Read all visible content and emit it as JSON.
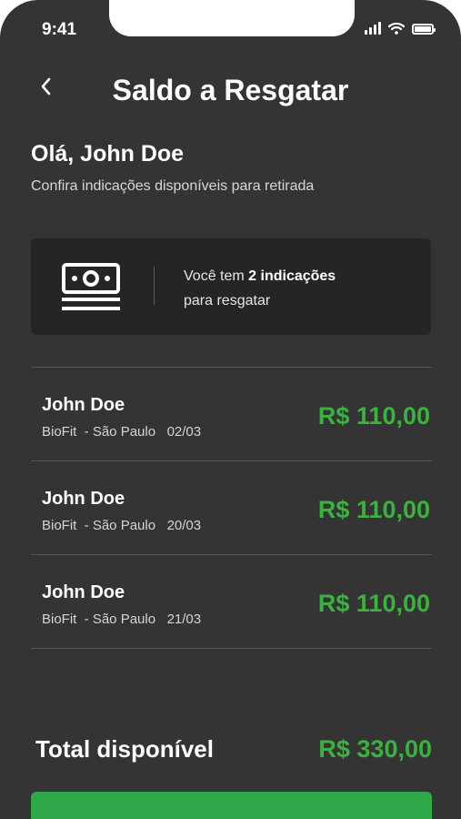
{
  "status_bar": {
    "time": "9:41"
  },
  "header": {
    "title": "Saldo a Resgatar"
  },
  "greeting": {
    "title": "Olá, John Doe",
    "subtitle": "Confira indicações disponíveis para retirada"
  },
  "summary_card": {
    "icon": "money-icon",
    "text_prefix": "Você tem ",
    "text_bold": "2 indicações",
    "text_suffix": "para resgatar"
  },
  "referrals": [
    {
      "name": "John Doe",
      "place": "BioFit  - São Paulo",
      "date": "02/03",
      "amount": "R$ 110,00"
    },
    {
      "name": "John Doe",
      "place": "BioFit  - São Paulo",
      "date": "20/03",
      "amount": "R$ 110,00"
    },
    {
      "name": "John Doe",
      "place": "BioFit  - São Paulo",
      "date": "21/03",
      "amount": "R$ 110,00"
    }
  ],
  "total": {
    "label": "Total disponível",
    "value": "R$ 330,00"
  },
  "colors": {
    "background": "#343434",
    "accent": "#3ab23e",
    "card": "#252525"
  }
}
